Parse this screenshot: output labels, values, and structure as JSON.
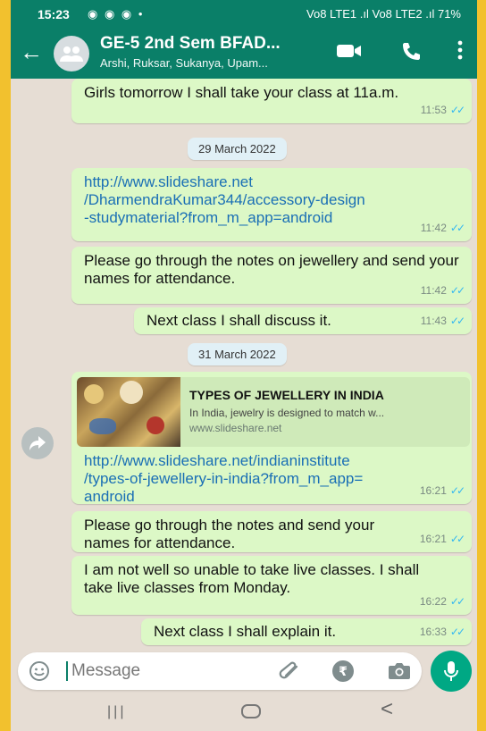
{
  "status_bar": {
    "time": "15:23",
    "notif_icons": "◉ ◉ ◉ •",
    "right_text": "Vo8 LTE1 .ıl Vo8 LTE2 .ıl 71%"
  },
  "header": {
    "title": "GE-5 2nd Sem BFAD...",
    "subtitle": "Arshi, Ruksar, Sukanya, Upam..."
  },
  "messages": [
    {
      "text": "Girls tomorrow I shall take your class at 11a.m.",
      "time": "11:53"
    },
    {
      "date": "29 March 2022"
    },
    {
      "text": "http://www.slideshare.net/DharmendraKumar344/accessory-design-studymaterial?from_m_app=android",
      "time": "11:42"
    },
    {
      "text": "Please go through the notes on jewellery and send your names for attendance.",
      "time": "11:42"
    },
    {
      "text": "Next class I shall discuss it.",
      "time": "11:43"
    },
    {
      "date": "31 March 2022"
    },
    {
      "preview": {
        "title": "TYPES OF JEWELLERY IN INDIA",
        "description": "In India, jewelry is designed to match w...",
        "domain": "www.slideshare.net"
      },
      "text": "http://www.slideshare.net/indianinstitute/types-of-jewellery-in-india?from_m_app=android",
      "time": "16:21"
    },
    {
      "text": "Please go through the notes and send your names for attendance.",
      "time": "16:21"
    },
    {
      "text": "I am not well so unable to take live classes. I shall take live classes from Monday.",
      "time": "16:22"
    },
    {
      "text": "Next class I shall explain it.",
      "time": "16:33"
    }
  ],
  "compose": {
    "placeholder": "Message",
    "rupee_symbol": "₹"
  },
  "tick_glyph": "✓✓",
  "colors": {
    "header": "#0a7f68",
    "bubble_out": "#dcf8c6",
    "read_ticks": "#34b7f1",
    "mic_button": "#00a884",
    "outer_border": "#f2c12e"
  }
}
